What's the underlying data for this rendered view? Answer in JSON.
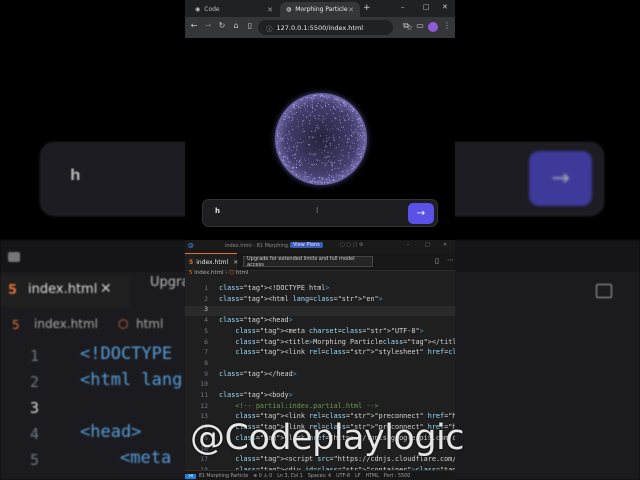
{
  "background": {
    "input_value": "h",
    "send_icon": "arrow-right-icon",
    "editor_tab": "index.html",
    "editor_tab_close": "✕",
    "editor_tooltip_fragment": "Upgra",
    "breadcrumb_file": "index.html",
    "breadcrumb_element": "html",
    "line_numbers": [
      "1",
      "2",
      "3",
      "4",
      "5"
    ],
    "code_lines": [
      "<!DOCTYPE",
      "<html lang",
      "",
      "<head>",
      "<meta"
    ]
  },
  "browser": {
    "tabs": [
      {
        "label": "Code",
        "icon": "code-icon"
      },
      {
        "label": "Morphing Particle",
        "icon": "globe-icon",
        "active": true
      }
    ],
    "new_tab": "+",
    "window_controls": [
      "–",
      "□",
      "✕"
    ],
    "url": "127.0.0.1:5500/index.html",
    "chat": {
      "input_value": "h",
      "send_icon": "arrow-right-icon"
    }
  },
  "vscode": {
    "title_text": "index.html - 81 Morphing...",
    "title_badge": "View Plans",
    "tab_label": "index.html",
    "tooltip": "Upgrade for extended limits and full model access",
    "breadcrumb": {
      "file": "index.html",
      "element": "html"
    },
    "lines": [
      {
        "n": "1",
        "code": "<!DOCTYPE html>"
      },
      {
        "n": "2",
        "code": "<html lang=\"en\">"
      },
      {
        "n": "3",
        "code": ""
      },
      {
        "n": "4",
        "code": "<head>"
      },
      {
        "n": "5",
        "code": "    <meta charset=\"UTF-8\">"
      },
      {
        "n": "6",
        "code": "    <title>Morphing Particle</title>"
      },
      {
        "n": "7",
        "code": "    <link rel=\"stylesheet\" href=\"./style.css\">"
      },
      {
        "n": "8",
        "code": ""
      },
      {
        "n": "9",
        "code": "</head>"
      },
      {
        "n": "10",
        "code": ""
      },
      {
        "n": "11",
        "code": "<body>"
      },
      {
        "n": "12",
        "code": "    <!-- partial:index.partial.html -->"
      },
      {
        "n": "13",
        "code": "    <link rel=\"preconnect\" href=\"https://fonts.googl"
      },
      {
        "n": "14",
        "code": "    <link rel=\"preconnect\" href=\"https://fonts.gstati"
      },
      {
        "n": "15",
        "code": "    <link href=\"https://fonts.googleapis.com/css2?fa"
      },
      {
        "n": "16",
        "code": ""
      },
      {
        "n": "17",
        "code": "    <script src=\"https://cdnjs.cloudflare.com/ajax/li"
      },
      {
        "n": "18",
        "code": "    <div id=\"container\"></div>"
      }
    ],
    "status": {
      "left": "81 Morphing Particle",
      "problems": "⊗ 0 ⚠ 0",
      "position": "Ln 3, Col 1",
      "spaces": "Spaces: 4",
      "encoding": "UTF-8",
      "eol": "LF",
      "language": "HTML",
      "port": "Port : 5500"
    }
  },
  "watermark": "@Codeplaylogic",
  "colors": {
    "accent": "#5a52e6",
    "sphere": "#a99cf5",
    "editor_bg": "#1f1f1f"
  }
}
